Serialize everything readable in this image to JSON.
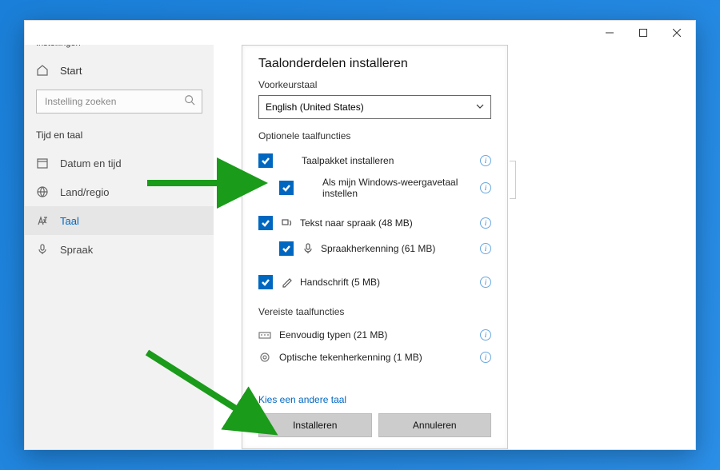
{
  "app_title": "Instellingen",
  "home_label": "Start",
  "search_placeholder": "Instelling zoeken",
  "category": "Tijd en taal",
  "nav": [
    {
      "label": "Datum en tijd"
    },
    {
      "label": "Land/regio"
    },
    {
      "label": "Taal"
    },
    {
      "label": "Spraak"
    }
  ],
  "dialog": {
    "title": "Taalonderdelen installeren",
    "preferred_label": "Voorkeurstaal",
    "selected_language": "English (United States)",
    "optional_heading": "Optionele taalfuncties",
    "options": {
      "install_pack": "Taalpakket installeren",
      "set_display": "Als mijn Windows-weergavetaal instellen",
      "tts": "Tekst naar spraak (48 MB)",
      "speech_rec": "Spraakherkenning (61 MB)",
      "handwriting": "Handschrift (5 MB)"
    },
    "required_heading": "Vereiste taalfuncties",
    "required": {
      "basic_typing": "Eenvoudig typen (21 MB)",
      "ocr": "Optische tekenherkenning (1 MB)"
    },
    "choose_other": "Kies een andere taal",
    "install_btn": "Installeren",
    "cancel_btn": "Annuleren"
  }
}
